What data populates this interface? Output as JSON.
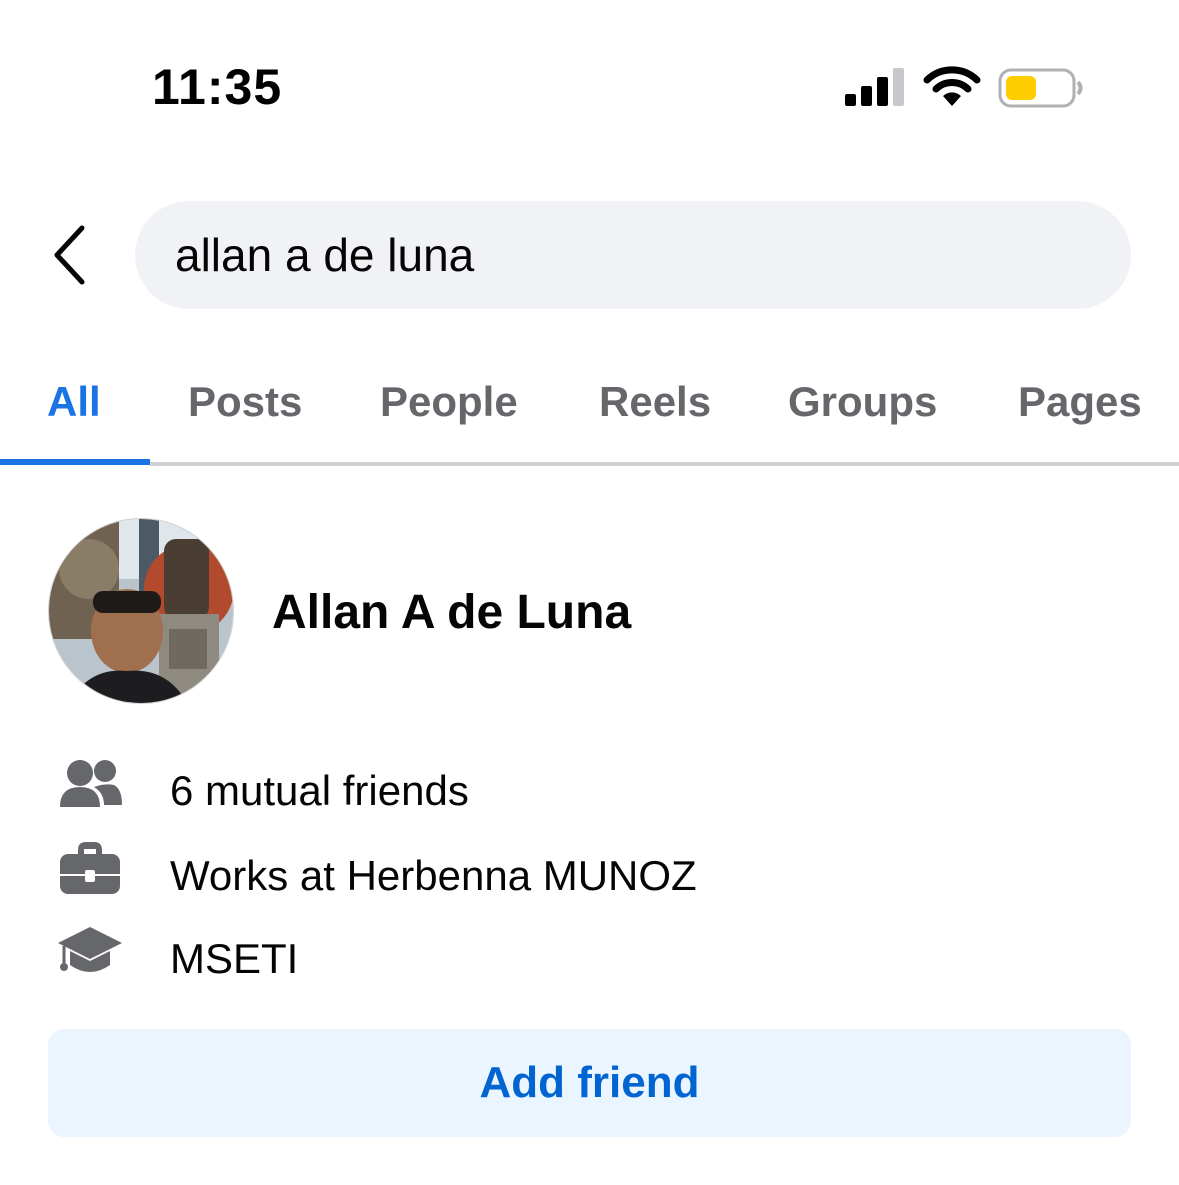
{
  "status_bar": {
    "time": "11:35",
    "signal_icon": "cellular-signal-icon",
    "wifi_icon": "wifi-icon",
    "battery_icon": "battery-icon",
    "battery_color": "#ffcc00"
  },
  "search": {
    "back_icon": "chevron-left-icon",
    "query": "allan a de luna"
  },
  "tabs": [
    {
      "label": "All",
      "active": true
    },
    {
      "label": "Posts",
      "active": false
    },
    {
      "label": "People",
      "active": false
    },
    {
      "label": "Reels",
      "active": false
    },
    {
      "label": "Groups",
      "active": false
    },
    {
      "label": "Pages",
      "active": false
    }
  ],
  "result": {
    "name": "Allan A de Luna",
    "details": [
      {
        "icon": "mutual-friends-icon",
        "text": "6 mutual friends"
      },
      {
        "icon": "briefcase-icon",
        "text": "Works at Herbenna MUNOZ"
      },
      {
        "icon": "graduation-cap-icon",
        "text": "MSETI"
      }
    ],
    "action_label": "Add friend"
  },
  "colors": {
    "accent": "#1b74e4",
    "button_bg": "#ebf5ff",
    "button_text": "#0064d1",
    "muted": "#65676b",
    "search_bg": "#f0f2f5"
  }
}
